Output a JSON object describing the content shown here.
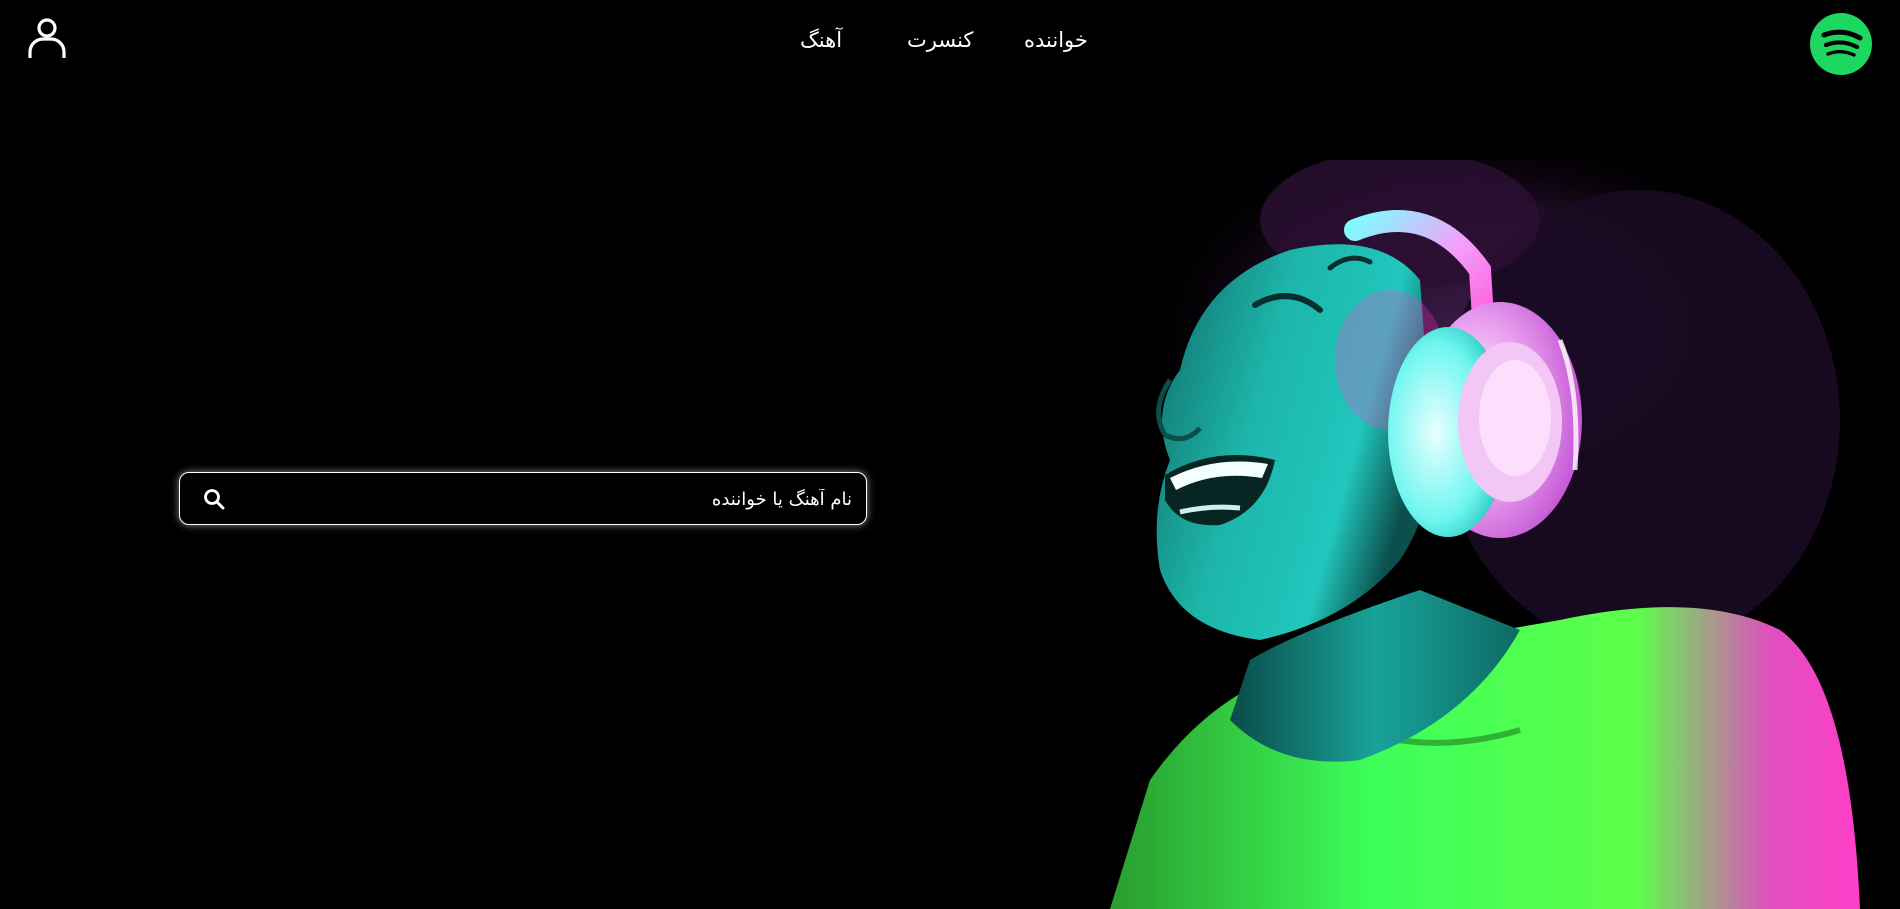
{
  "header": {
    "user_icon": "user-icon",
    "logo_icon": "spotify-logo",
    "nav": {
      "song": "آهنگ",
      "concert": "کنسرت",
      "singer": "خواننده"
    }
  },
  "search": {
    "placeholder": "نام آهنگ یا خواننده",
    "value": "",
    "icon": "search-icon"
  },
  "hero": {
    "image": "woman-with-headphones-neon"
  },
  "colors": {
    "background": "#000000",
    "brand_green": "#1ed760",
    "text": "#ffffff",
    "neon_cyan": "#2fe6d8",
    "neon_pink": "#ff3ec8",
    "neon_green": "#3dff5a"
  }
}
